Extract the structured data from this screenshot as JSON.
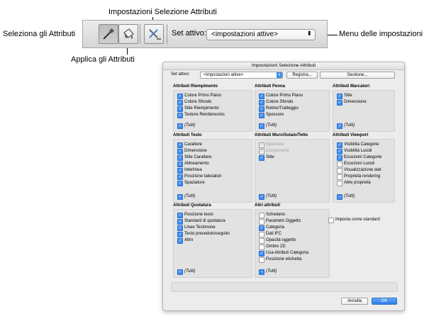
{
  "callouts": {
    "top": "Impostazioni Selezione Attributi",
    "left": "Seleziona gli Attributi",
    "bottom": "Applica gli Attributi",
    "right": "Menu delle impostazioni"
  },
  "toolbar": {
    "select_tool_icon": "eyedropper-icon",
    "apply_tool_icon": "paint-bucket-icon",
    "settings_icon": "settings-tools-icon",
    "set_label": "Set attivo:",
    "set_value": "<impostazioni attive>",
    "dropdown_arrow": "⬍"
  },
  "dialog": {
    "title": "Impostazioni Selezione Attributi",
    "set_label": "Set attivo:",
    "set_value": "<impostazioni attive>",
    "register_button": "Registra...",
    "manage_button": "Gestione...",
    "standard_label": "Imposta come standard",
    "cancel_button": "Annulla",
    "ok_button": "OK",
    "groups": {
      "fill": {
        "title": "Attributi Riempimento",
        "items": [
          {
            "label": "Colore Primo Piano",
            "state": "on"
          },
          {
            "label": "Colore Sfondo",
            "state": "on"
          },
          {
            "label": "Stile Riempimento",
            "state": "on"
          },
          {
            "label": "Texture Renderworks",
            "state": "on"
          }
        ],
        "all": {
          "label": "(Tutti)",
          "state": "on"
        }
      },
      "pen": {
        "title": "Attributi Penna",
        "items": [
          {
            "label": "Colore Primo Piano",
            "state": "on"
          },
          {
            "label": "Colore Sfondo",
            "state": "on"
          },
          {
            "label": "Retino/Tratteggio",
            "state": "on"
          },
          {
            "label": "Spessore",
            "state": "on"
          }
        ],
        "all": {
          "label": "(Tutti)",
          "state": "on"
        }
      },
      "markers": {
        "title": "Attributi Marcatori",
        "items": [
          {
            "label": "Stile",
            "state": "on"
          },
          {
            "label": "Dimensione",
            "state": "on"
          }
        ],
        "all": {
          "label": "(Tutti)",
          "state": "on"
        }
      },
      "text": {
        "title": "Attributi Testo",
        "items": [
          {
            "label": "Carattere",
            "state": "on"
          },
          {
            "label": "Dimensione",
            "state": "on"
          },
          {
            "label": "Stile Carattere",
            "state": "on"
          },
          {
            "label": "Allineamento",
            "state": "on"
          },
          {
            "label": "Interlinea",
            "state": "on"
          },
          {
            "label": "Posizione tabulatori",
            "state": "on"
          },
          {
            "label": "Spaziature",
            "state": "on"
          }
        ],
        "all": {
          "label": "(Tutti)",
          "state": "on"
        }
      },
      "wall": {
        "title": "Attributi Muro/Solaio/Tetto",
        "items": [
          {
            "label": "Spessore",
            "state": "dis"
          },
          {
            "label": "Componenti",
            "state": "dis"
          },
          {
            "label": "Stile",
            "state": "on"
          }
        ],
        "all": {
          "label": "(Tutti)",
          "state": "on"
        }
      },
      "viewport": {
        "title": "Attributi Viewport",
        "items": [
          {
            "label": "Visibilità Categorie",
            "state": "on"
          },
          {
            "label": "Visibilità Lucidi",
            "state": "on"
          },
          {
            "label": "Eccezioni Categorie",
            "state": "on"
          },
          {
            "label": "Eccezioni Lucidi",
            "state": "off"
          },
          {
            "label": "Visualizzazione dati",
            "state": "off"
          },
          {
            "label": "Proprietà rendering",
            "state": "off"
          },
          {
            "label": "Altre proprietà",
            "state": "off"
          }
        ],
        "all": {
          "label": "(Tutti)",
          "state": "mixed"
        }
      },
      "dimension": {
        "title": "Attributi Quotatura",
        "items": [
          {
            "label": "Posizione testo",
            "state": "on"
          },
          {
            "label": "Standard di quotatura",
            "state": "on"
          },
          {
            "label": "Linee Testimone",
            "state": "on"
          },
          {
            "label": "Testo preceduto/seguito",
            "state": "on"
          },
          {
            "label": "Altro",
            "state": "on"
          }
        ],
        "all": {
          "label": "(Tutti)",
          "state": "on"
        }
      },
      "other": {
        "title": "Altri attributi",
        "items": [
          {
            "label": "Schedario",
            "state": "off"
          },
          {
            "label": "Parametri Oggetto",
            "state": "off"
          },
          {
            "label": "Categoria",
            "state": "on"
          },
          {
            "label": "Dati IFC",
            "state": "off"
          },
          {
            "label": "Opacità oggetto",
            "state": "off"
          },
          {
            "label": "Ombre 2D",
            "state": "off"
          },
          {
            "label": "Usa Attributi Categoria",
            "state": "on"
          },
          {
            "label": "Posizione etichetta",
            "state": "off"
          }
        ],
        "all": {
          "label": "(Tutti)",
          "state": "mixed"
        }
      }
    }
  }
}
